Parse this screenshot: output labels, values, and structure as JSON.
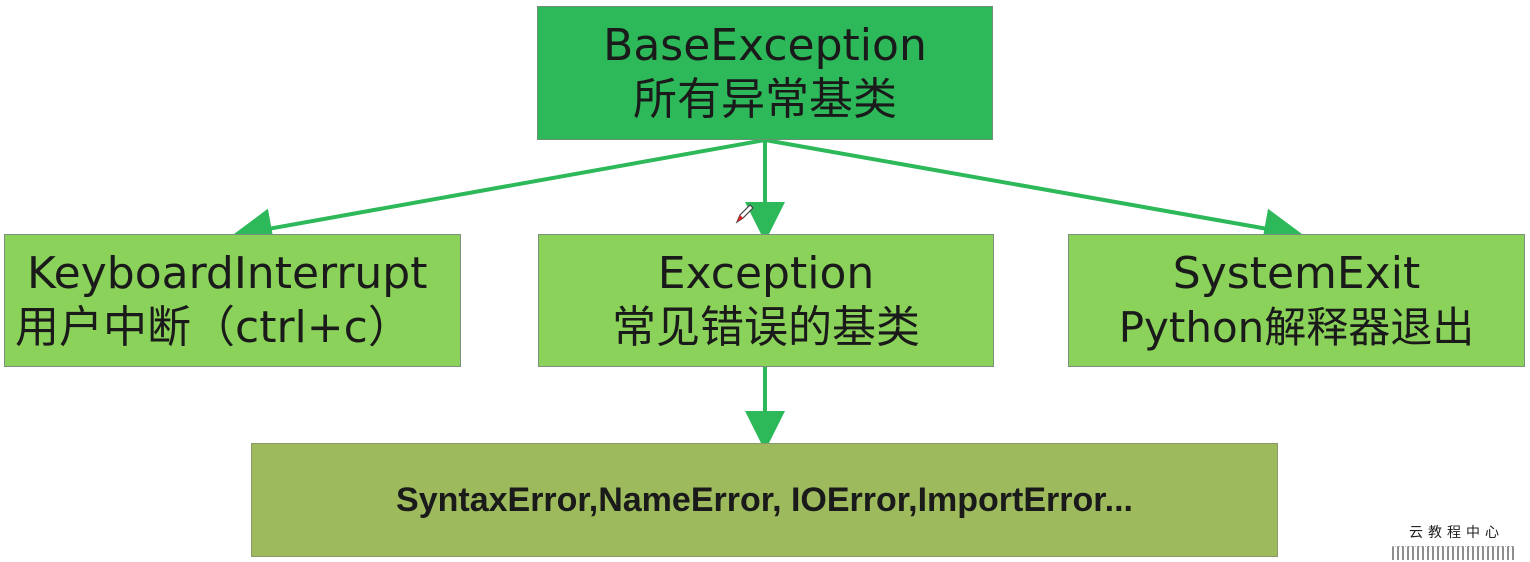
{
  "colors": {
    "root_fill": "#2db85a",
    "mid_fill": "#8ad25a",
    "leaf_fill": "#9dbb5c",
    "connector": "#2db85a"
  },
  "nodes": {
    "root": {
      "line1": "BaseException",
      "line2": "所有异常基类"
    },
    "keyboard_interrupt": {
      "line1": "KeyboardInterrupt",
      "line2": "用户中断（ctrl+c）"
    },
    "exception": {
      "line1": "Exception",
      "line2": "常见错误的基类"
    },
    "system_exit": {
      "line1": "SystemExit",
      "line2": "Python解释器退出"
    },
    "common_errors": {
      "line1": "SyntaxError,NameError, IOError,ImportError..."
    }
  },
  "edges": [
    {
      "from": "root",
      "to": "keyboard_interrupt"
    },
    {
      "from": "root",
      "to": "exception"
    },
    {
      "from": "root",
      "to": "system_exit"
    },
    {
      "from": "exception",
      "to": "common_errors"
    }
  ],
  "watermark": {
    "text": "云教程中心"
  },
  "icons": {
    "cursor": "pen-cursor-icon"
  }
}
